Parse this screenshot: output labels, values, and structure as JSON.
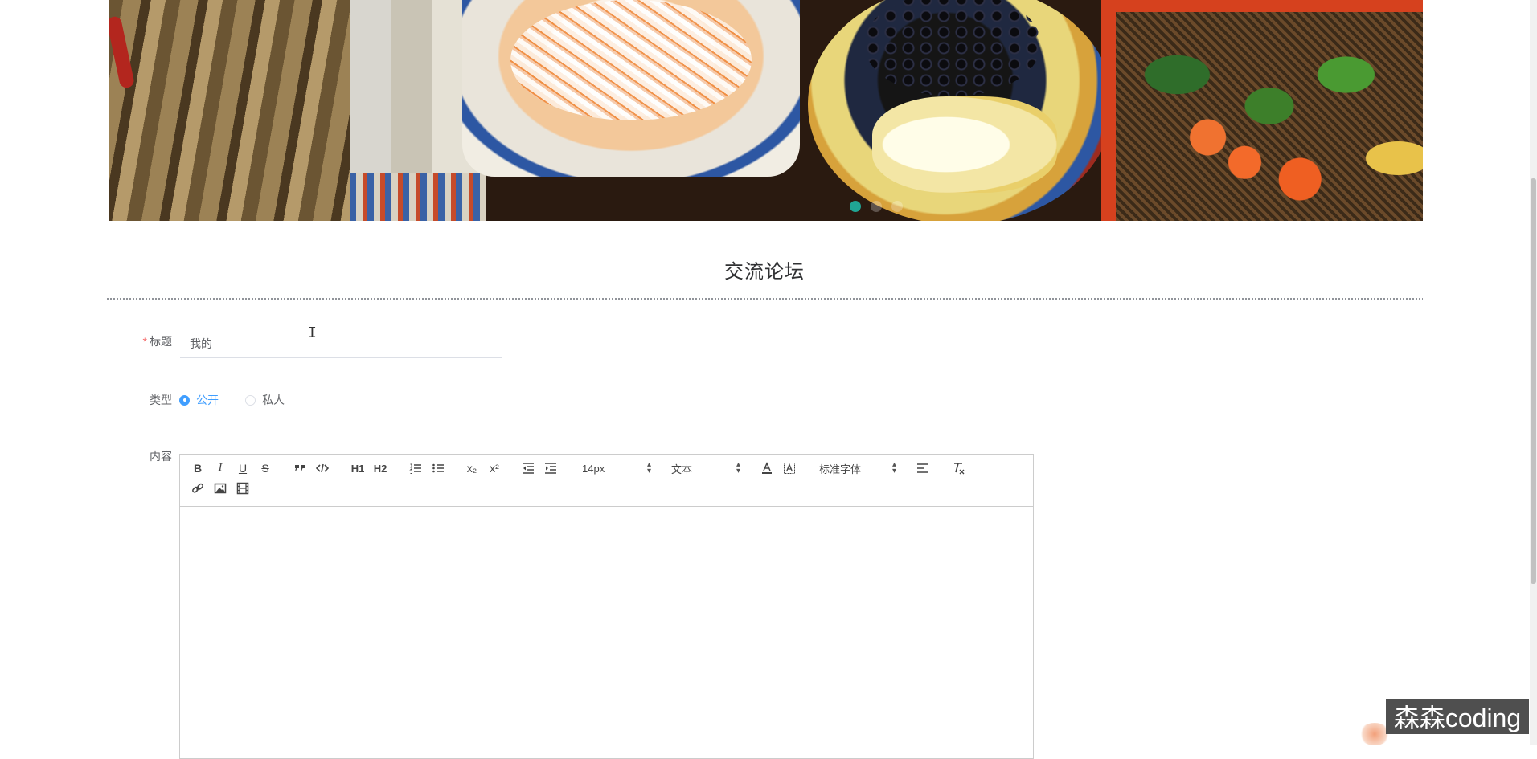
{
  "banner": {
    "slide_count": 3,
    "active_index": 0,
    "accent_color": "#20a594",
    "next_icon": "chevron-right-icon"
  },
  "page": {
    "title": "交流论坛"
  },
  "form": {
    "title": {
      "label": "标题",
      "required_mark": "*",
      "value": "我的"
    },
    "type": {
      "label": "类型",
      "options": [
        {
          "label": "公开",
          "checked": true
        },
        {
          "label": "私人",
          "checked": false
        }
      ],
      "selected_color": "#409eff"
    },
    "content": {
      "label": "内容"
    }
  },
  "editor": {
    "toolbar": {
      "bold": "B",
      "italic": "I",
      "underline": "U",
      "strike": "S",
      "h1": "H1",
      "h2": "H2",
      "sub": "x₂",
      "sup": "x²",
      "size": "14px",
      "header": "文本",
      "font": "标准字体",
      "icons": [
        "quote-icon",
        "code-icon",
        "ordered-list-icon",
        "bullet-list-icon",
        "outdent-icon",
        "indent-icon",
        "font-color-icon",
        "background-color-icon",
        "align-left-icon",
        "clear-format-icon",
        "link-icon",
        "image-icon",
        "video-icon"
      ]
    },
    "body": ""
  },
  "watermark": {
    "text": "森森coding"
  }
}
